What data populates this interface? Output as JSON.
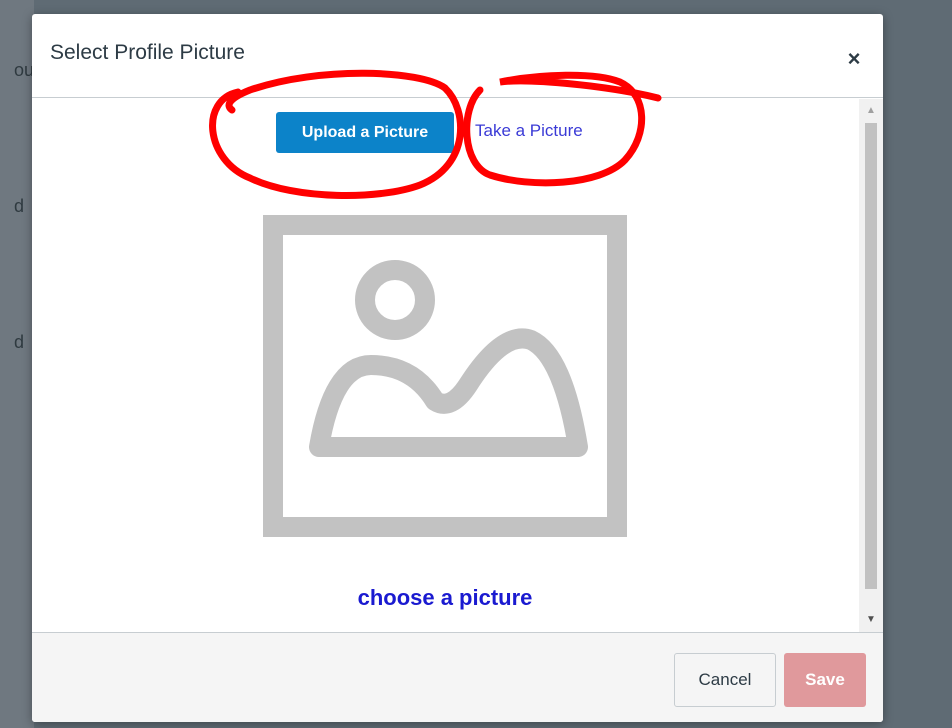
{
  "background": {
    "partial_text": [
      "ou",
      "d",
      "d"
    ]
  },
  "dialog": {
    "title": "Select Profile Picture",
    "close_glyph": "×"
  },
  "body": {
    "upload_label": "Upload a Picture",
    "take_label": "Take a Picture",
    "placeholder_icon": "image-placeholder-icon",
    "choose_label": "choose a picture"
  },
  "footer": {
    "cancel_label": "Cancel",
    "save_label": "Save"
  },
  "colors": {
    "primary": "#0c83c9",
    "link": "#1a1ad0",
    "save_disabled": "#e0999c",
    "annotation": "#ff0000"
  }
}
